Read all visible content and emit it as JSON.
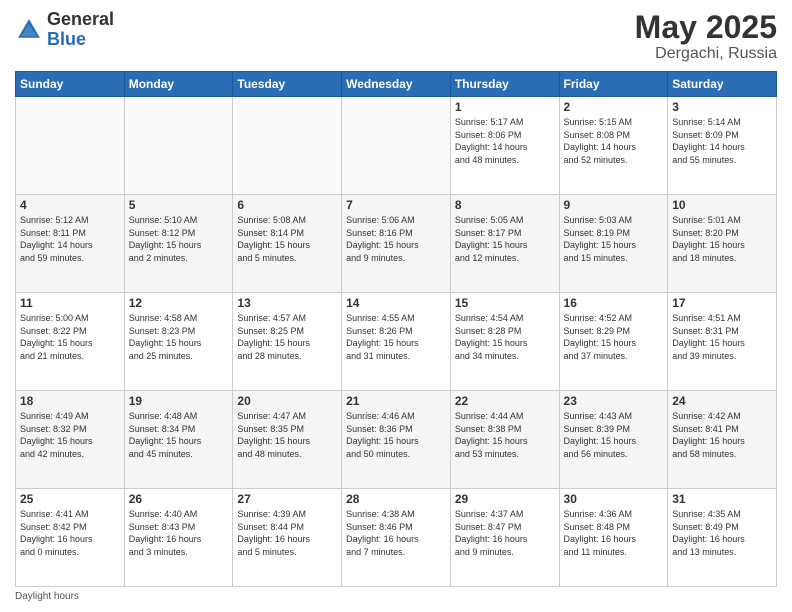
{
  "header": {
    "logo_general": "General",
    "logo_blue": "Blue",
    "title": "May 2025",
    "location": "Dergachi, Russia"
  },
  "weekdays": [
    "Sunday",
    "Monday",
    "Tuesday",
    "Wednesday",
    "Thursday",
    "Friday",
    "Saturday"
  ],
  "weeks": [
    [
      {
        "day": "",
        "info": ""
      },
      {
        "day": "",
        "info": ""
      },
      {
        "day": "",
        "info": ""
      },
      {
        "day": "",
        "info": ""
      },
      {
        "day": "1",
        "info": "Sunrise: 5:17 AM\nSunset: 8:06 PM\nDaylight: 14 hours\nand 48 minutes."
      },
      {
        "day": "2",
        "info": "Sunrise: 5:15 AM\nSunset: 8:08 PM\nDaylight: 14 hours\nand 52 minutes."
      },
      {
        "day": "3",
        "info": "Sunrise: 5:14 AM\nSunset: 8:09 PM\nDaylight: 14 hours\nand 55 minutes."
      }
    ],
    [
      {
        "day": "4",
        "info": "Sunrise: 5:12 AM\nSunset: 8:11 PM\nDaylight: 14 hours\nand 59 minutes."
      },
      {
        "day": "5",
        "info": "Sunrise: 5:10 AM\nSunset: 8:12 PM\nDaylight: 15 hours\nand 2 minutes."
      },
      {
        "day": "6",
        "info": "Sunrise: 5:08 AM\nSunset: 8:14 PM\nDaylight: 15 hours\nand 5 minutes."
      },
      {
        "day": "7",
        "info": "Sunrise: 5:06 AM\nSunset: 8:16 PM\nDaylight: 15 hours\nand 9 minutes."
      },
      {
        "day": "8",
        "info": "Sunrise: 5:05 AM\nSunset: 8:17 PM\nDaylight: 15 hours\nand 12 minutes."
      },
      {
        "day": "9",
        "info": "Sunrise: 5:03 AM\nSunset: 8:19 PM\nDaylight: 15 hours\nand 15 minutes."
      },
      {
        "day": "10",
        "info": "Sunrise: 5:01 AM\nSunset: 8:20 PM\nDaylight: 15 hours\nand 18 minutes."
      }
    ],
    [
      {
        "day": "11",
        "info": "Sunrise: 5:00 AM\nSunset: 8:22 PM\nDaylight: 15 hours\nand 21 minutes."
      },
      {
        "day": "12",
        "info": "Sunrise: 4:58 AM\nSunset: 8:23 PM\nDaylight: 15 hours\nand 25 minutes."
      },
      {
        "day": "13",
        "info": "Sunrise: 4:57 AM\nSunset: 8:25 PM\nDaylight: 15 hours\nand 28 minutes."
      },
      {
        "day": "14",
        "info": "Sunrise: 4:55 AM\nSunset: 8:26 PM\nDaylight: 15 hours\nand 31 minutes."
      },
      {
        "day": "15",
        "info": "Sunrise: 4:54 AM\nSunset: 8:28 PM\nDaylight: 15 hours\nand 34 minutes."
      },
      {
        "day": "16",
        "info": "Sunrise: 4:52 AM\nSunset: 8:29 PM\nDaylight: 15 hours\nand 37 minutes."
      },
      {
        "day": "17",
        "info": "Sunrise: 4:51 AM\nSunset: 8:31 PM\nDaylight: 15 hours\nand 39 minutes."
      }
    ],
    [
      {
        "day": "18",
        "info": "Sunrise: 4:49 AM\nSunset: 8:32 PM\nDaylight: 15 hours\nand 42 minutes."
      },
      {
        "day": "19",
        "info": "Sunrise: 4:48 AM\nSunset: 8:34 PM\nDaylight: 15 hours\nand 45 minutes."
      },
      {
        "day": "20",
        "info": "Sunrise: 4:47 AM\nSunset: 8:35 PM\nDaylight: 15 hours\nand 48 minutes."
      },
      {
        "day": "21",
        "info": "Sunrise: 4:46 AM\nSunset: 8:36 PM\nDaylight: 15 hours\nand 50 minutes."
      },
      {
        "day": "22",
        "info": "Sunrise: 4:44 AM\nSunset: 8:38 PM\nDaylight: 15 hours\nand 53 minutes."
      },
      {
        "day": "23",
        "info": "Sunrise: 4:43 AM\nSunset: 8:39 PM\nDaylight: 15 hours\nand 56 minutes."
      },
      {
        "day": "24",
        "info": "Sunrise: 4:42 AM\nSunset: 8:41 PM\nDaylight: 15 hours\nand 58 minutes."
      }
    ],
    [
      {
        "day": "25",
        "info": "Sunrise: 4:41 AM\nSunset: 8:42 PM\nDaylight: 16 hours\nand 0 minutes."
      },
      {
        "day": "26",
        "info": "Sunrise: 4:40 AM\nSunset: 8:43 PM\nDaylight: 16 hours\nand 3 minutes."
      },
      {
        "day": "27",
        "info": "Sunrise: 4:39 AM\nSunset: 8:44 PM\nDaylight: 16 hours\nand 5 minutes."
      },
      {
        "day": "28",
        "info": "Sunrise: 4:38 AM\nSunset: 8:46 PM\nDaylight: 16 hours\nand 7 minutes."
      },
      {
        "day": "29",
        "info": "Sunrise: 4:37 AM\nSunset: 8:47 PM\nDaylight: 16 hours\nand 9 minutes."
      },
      {
        "day": "30",
        "info": "Sunrise: 4:36 AM\nSunset: 8:48 PM\nDaylight: 16 hours\nand 11 minutes."
      },
      {
        "day": "31",
        "info": "Sunrise: 4:35 AM\nSunset: 8:49 PM\nDaylight: 16 hours\nand 13 minutes."
      }
    ]
  ],
  "footer": {
    "note": "Daylight hours"
  }
}
